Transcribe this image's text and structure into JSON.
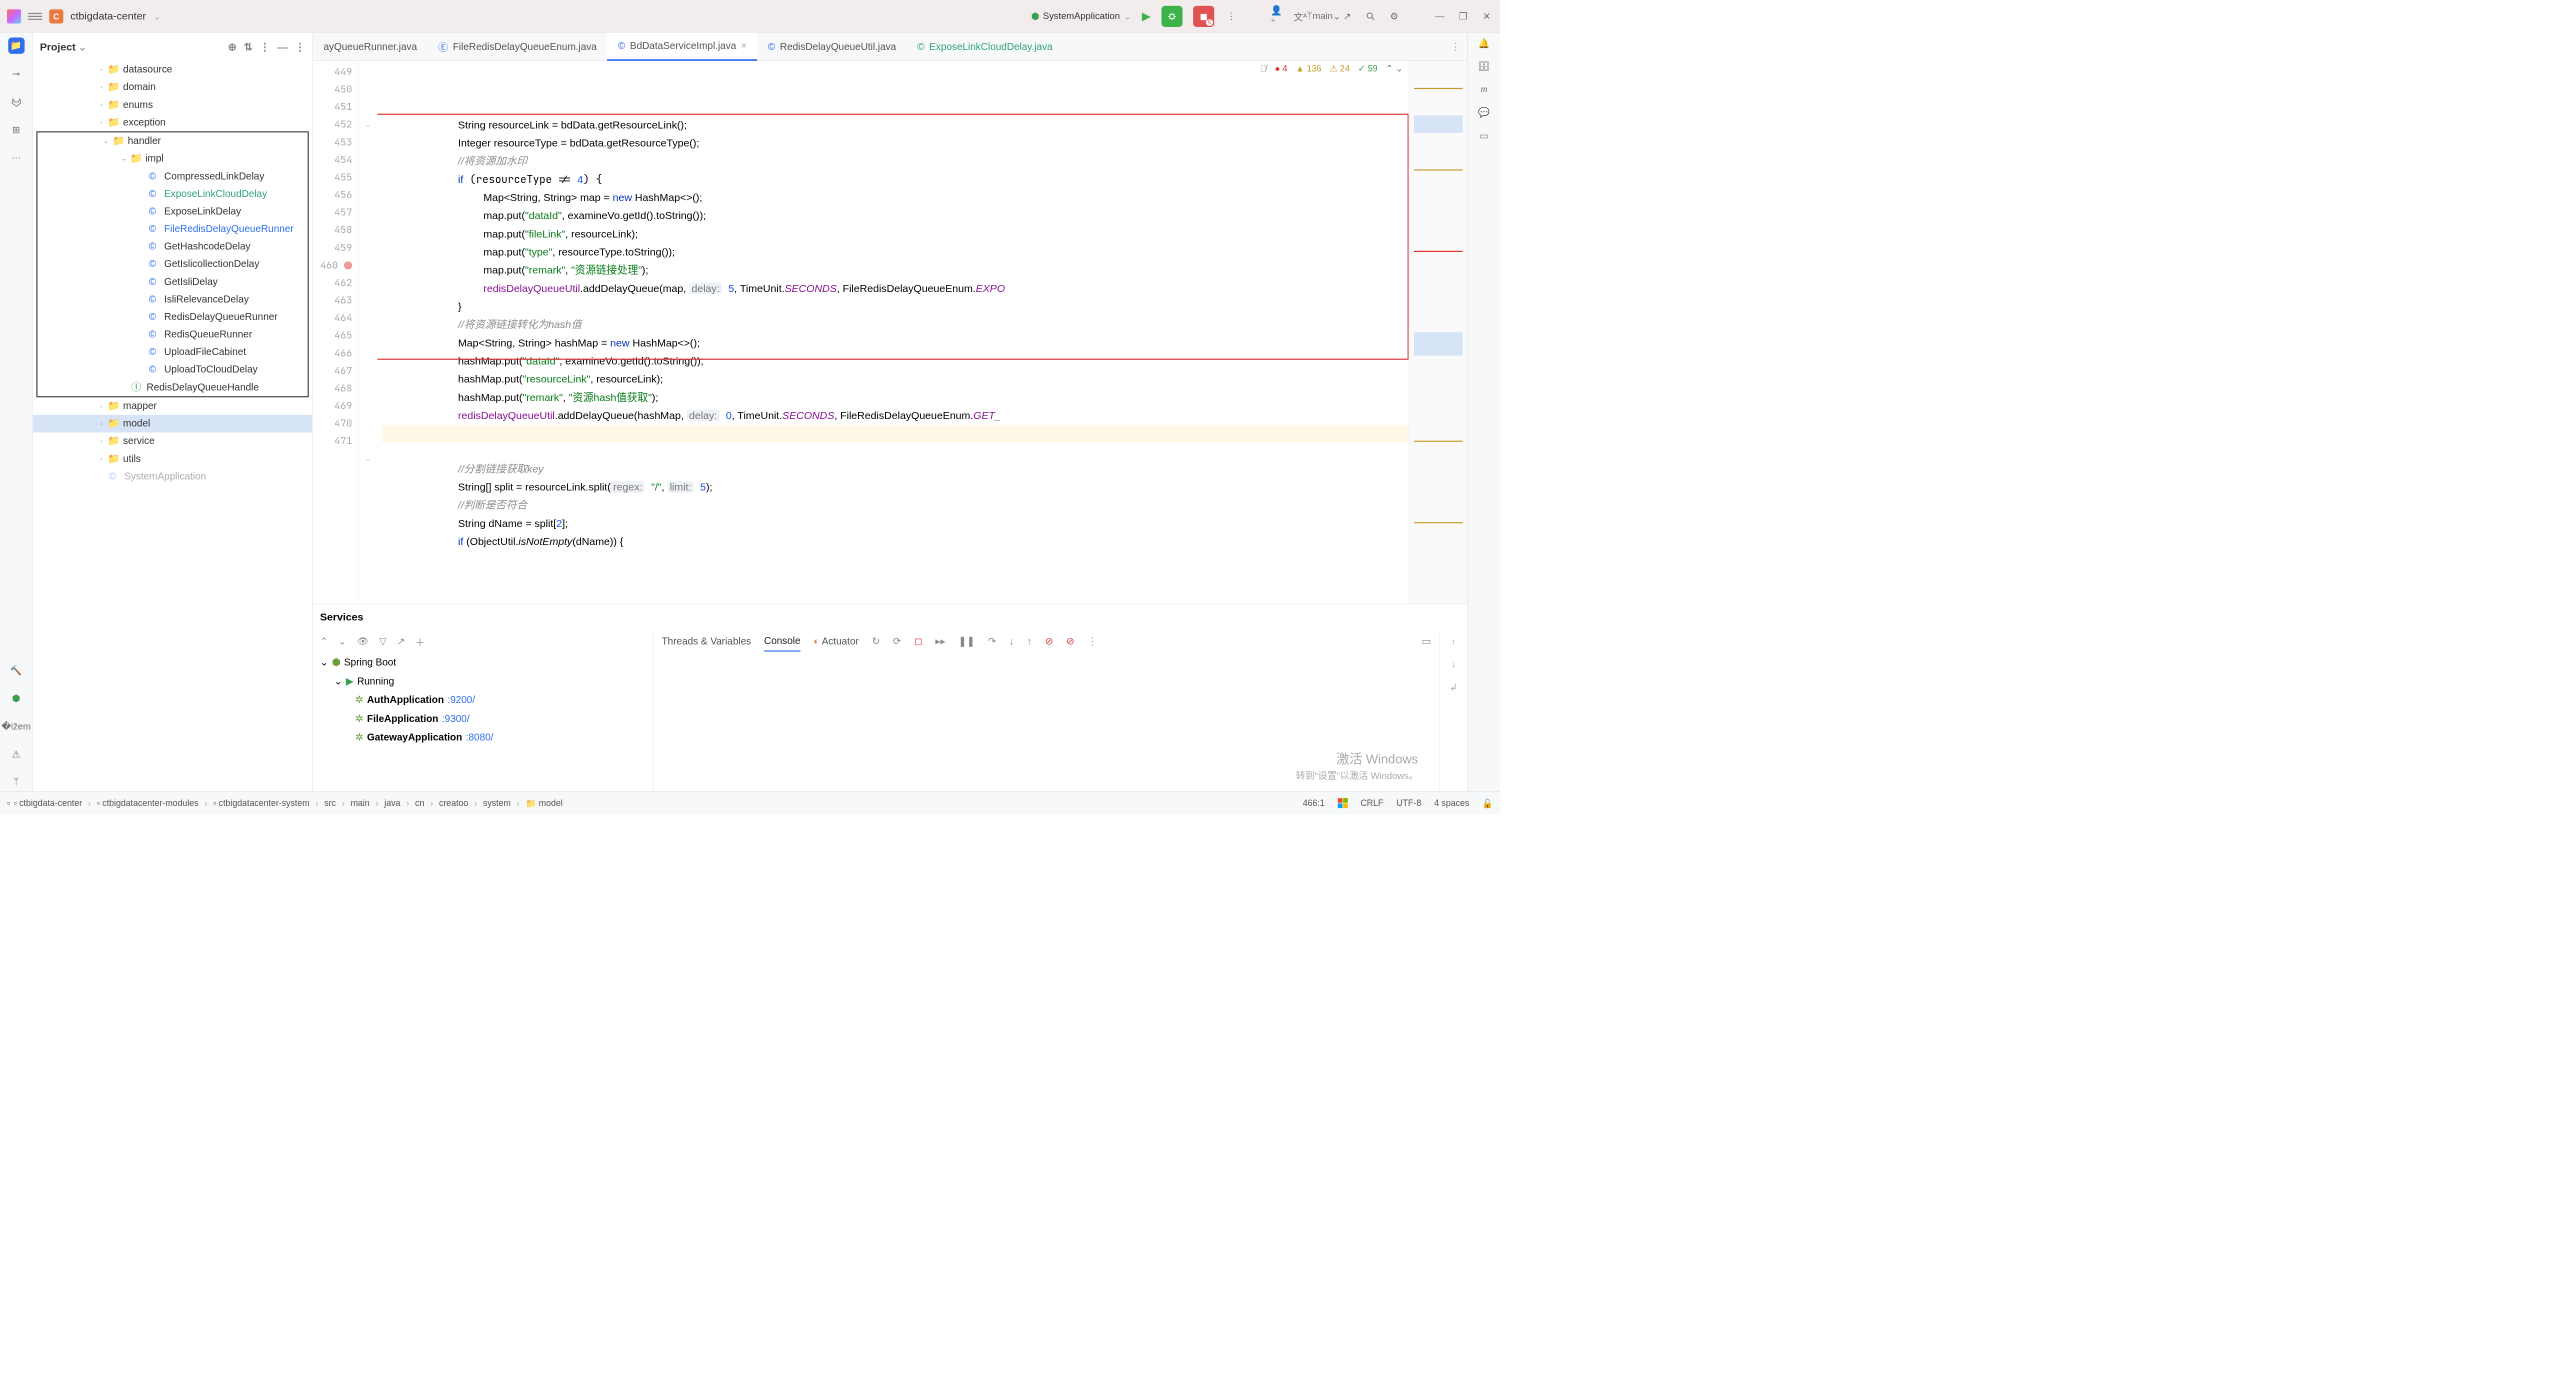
{
  "titlebar": {
    "project_letter": "C",
    "project_name": "ctbigdata-center",
    "run_config": "SystemApplication",
    "debug_badge": "6",
    "branch": "main"
  },
  "project": {
    "title": "Project",
    "tree": {
      "datasource": "datasource",
      "domain": "domain",
      "enums": "enums",
      "exception": "exception",
      "handler": "handler",
      "impl": "impl",
      "items": [
        "CompressedLinkDelay",
        "ExposeLinkCloudDelay",
        "ExposeLinkDelay",
        "FileRedisDelayQueueRunner",
        "GetHashcodeDelay",
        "GetIslicollectionDelay",
        "GetIsliDelay",
        "IsliRelevanceDelay",
        "RedisDelayQueueRunner",
        "RedisQueueRunner",
        "UploadFileCabinet",
        "UploadToCloudDelay"
      ],
      "redisq": "RedisDelayQueueHandle",
      "mapper": "mapper",
      "model": "model",
      "service": "service",
      "utils": "utils",
      "sysapp": "SystemApplication"
    }
  },
  "tabs": {
    "t0": "ayQueueRunner.java",
    "t1": "FileRedisDelayQueueEnum.java",
    "t2": "BdDataServiceImpl.java",
    "t3": "RedisDelayQueueUtil.java",
    "t4": "ExposeLinkCloudDelay.java"
  },
  "editor_status": {
    "errors": "4",
    "warn1": "136",
    "warn2": "24",
    "ok": "59"
  },
  "gutter": {
    "start": 449,
    "end": 471
  },
  "code": {
    "l449": "String resourceLink = bdData.getResourceLink();",
    "l450": "Integer resourceType = bdData.getResourceType();",
    "l451c": "//将资源加水印",
    "l454": "Map<String, String> map = ",
    "l454n": "new",
    "l454b": " HashMap<>();",
    "l455a": "map.put(",
    "l455s": "\"dataId\"",
    "l455b": ", examineVo.getId().toString());",
    "l456a": "map.put(",
    "l456s": "\"fileLink\"",
    "l456b": ", resourceLink);",
    "l457a": "map.put(",
    "l457s": "\"type\"",
    "l457b": ", resourceType.toString());",
    "l458a": "map.put(",
    "l458s": "\"remark\"",
    "l458b": ", ",
    "l458s2": "\"资源链接处理\"",
    "l458c": ");",
    "l459a": ".addDelayQueue(map, ",
    "l459h": "delay:",
    "l459n": "5",
    "l459b": ", TimeUnit.",
    "l459f": "SECONDS",
    "l459c": ", FileRedisDelayQueueEnum.",
    "l459f2": "EXPO",
    "l460": "}",
    "l461c": "//将资源链接转化为hash值",
    "l462a": "Map<String, String> hashMap = ",
    "l462n": "new",
    "l462b": " HashMap<>();",
    "l463a": "hashMap.put(",
    "l463s": "\"dataId\"",
    "l463b": ", examineVo.getId().toString());",
    "l464a": "hashMap.put(",
    "l464s": "\"resourceLink\"",
    "l464b": ", resourceLink);",
    "l465a": "hashMap.put(",
    "l465s": "\"remark\"",
    "l465b": ", ",
    "l465s2": "\"资源hash值获取\"",
    "l465c": ");",
    "l466a": ".addDelayQueue(hashMap, ",
    "l466h": "delay:",
    "l466n": "0",
    "l466b": ", TimeUnit.",
    "l466f": "SECONDS",
    "l466c": ", FileRedisDelayQueueEnum.",
    "l466f2": "GET_",
    "l468c": "//分割链接获取key",
    "l469a": "String[] split = resourceLink.split(",
    "l469h1": "regex:",
    "l469s": "\"/\"",
    "l469b": ", ",
    "l469h2": "limit:",
    "l469n": "5",
    "l469c": ");",
    "l470c": "//判断是否符合",
    "l471a": "String dName = split[",
    "l471n": "2",
    "l471b": "];",
    "l472a": "if",
    "l472b": " (ObjectUtil.",
    "l472i": "isNotEmpty",
    "l472c": "(dName)) {",
    "rdqu": "redisDelayQueueUtil"
  },
  "services": {
    "title": "Services",
    "spring": "Spring Boot",
    "running": "Running",
    "apps": [
      {
        "name": "AuthApplication",
        "port": ":9200/"
      },
      {
        "name": "FileApplication",
        "port": ":9300/"
      },
      {
        "name": "GatewayApplication",
        "port": ":8080/"
      }
    ],
    "tabs": {
      "tv": "Threads & Variables",
      "console": "Console",
      "actuator": "Actuator"
    }
  },
  "breadcrumbs": [
    "ctbigdata-center",
    "ctbigdatacenter-modules",
    "ctbigdatacenter-system",
    "src",
    "main",
    "java",
    "cn",
    "creatoo",
    "system",
    "model"
  ],
  "status": {
    "pos": "466:1",
    "le": "CRLF",
    "enc": "UTF-8",
    "indent": "4 spaces"
  },
  "activate": {
    "t1": "激活 Windows",
    "t2": "转到\"设置\"以激活 Windows。"
  }
}
